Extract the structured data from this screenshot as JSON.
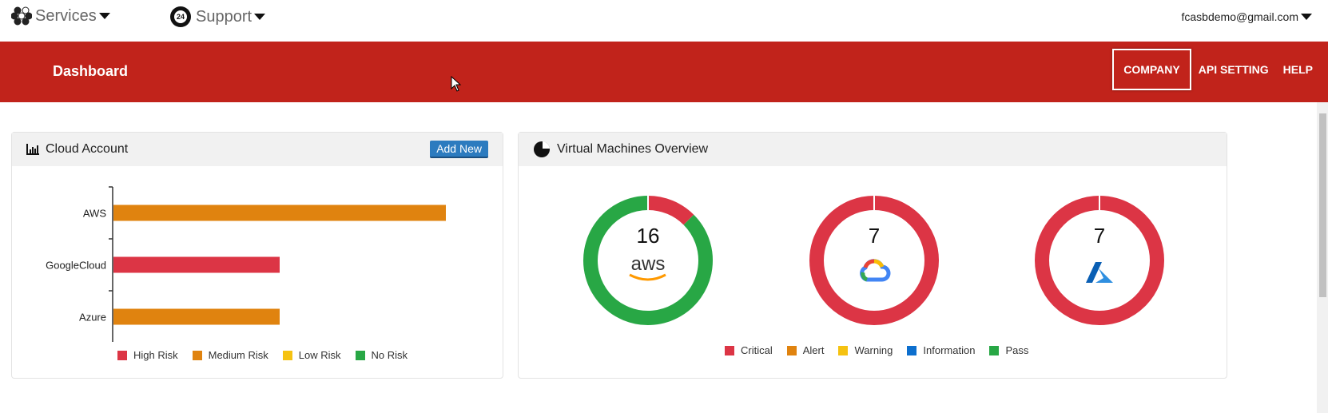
{
  "topbar": {
    "services": "Services",
    "support": "Support",
    "support_badge": "24",
    "user_email": "fcasbdemo@gmail.com"
  },
  "header": {
    "title": "Dashboard",
    "nav": [
      "COMPANY",
      "API SETTING",
      "HELP"
    ]
  },
  "cloud_account": {
    "title": "Cloud Account",
    "add_button": "Add New"
  },
  "vm_overview": {
    "title": "Virtual Machines Overview",
    "donuts": [
      {
        "provider": "aws",
        "total": "16",
        "critical": 2,
        "alert": 0,
        "warning": 0,
        "information": 0,
        "pass": 14
      },
      {
        "provider": "GoogleCloud",
        "total": "7",
        "critical": 7,
        "alert": 0,
        "warning": 0,
        "information": 0,
        "pass": 0
      },
      {
        "provider": "Azure",
        "total": "7",
        "critical": 7,
        "alert": 0,
        "warning": 0,
        "information": 0,
        "pass": 0
      }
    ],
    "legend": [
      {
        "label": "Critical",
        "color": "#dc3545"
      },
      {
        "label": "Alert",
        "color": "#e0830f"
      },
      {
        "label": "Warning",
        "color": "#f5c211"
      },
      {
        "label": "Information",
        "color": "#0d6fce"
      },
      {
        "label": "Pass",
        "color": "#28a745"
      }
    ]
  },
  "chart_data": {
    "type": "bar",
    "orientation": "horizontal",
    "categories": [
      "AWS",
      "GoogleCloud",
      "Azure"
    ],
    "values": [
      4,
      2,
      2
    ],
    "colors": [
      "#e0830f",
      "#dc3545",
      "#e0830f"
    ],
    "risk": [
      "Medium Risk",
      "High Risk",
      "Medium Risk"
    ],
    "legend": [
      {
        "label": "High Risk",
        "color": "#dc3545"
      },
      {
        "label": "Medium Risk",
        "color": "#e0830f"
      },
      {
        "label": "Low Risk",
        "color": "#f5c211"
      },
      {
        "label": "No Risk",
        "color": "#28a745"
      }
    ],
    "xlim": [
      0,
      4
    ]
  },
  "aws_logo": "aws"
}
